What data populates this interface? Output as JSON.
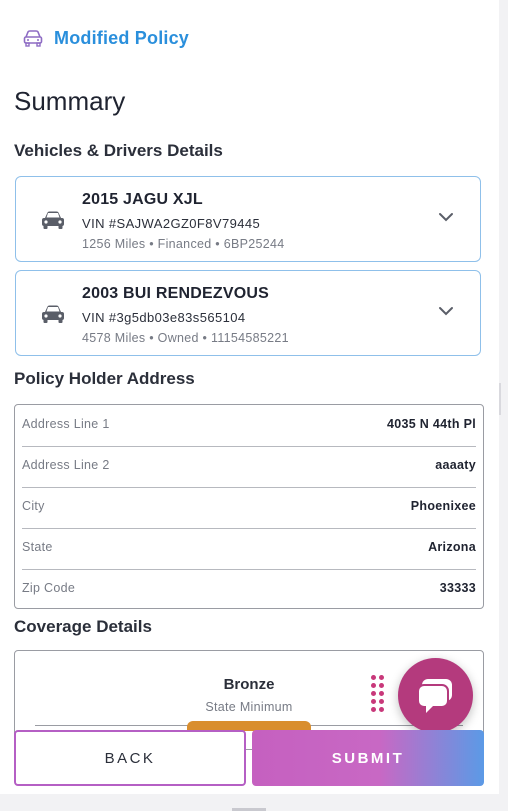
{
  "header": {
    "title": "Modified Policy",
    "icon": "car-outline-icon"
  },
  "summary_title": "Summary",
  "vehicles_section_title": "Vehicles & Drivers Details",
  "vehicles": [
    {
      "title": "2015 JAGU XJL",
      "vin": "VIN #SAJWA2GZ0F8V79445",
      "meta": "1256 Miles • Financed • 6BP25244"
    },
    {
      "title": "2003 BUI RENDEZVOUS",
      "vin": "VIN #3g5db03e83s565104",
      "meta": "4578 Miles • Owned • 11154585221"
    }
  ],
  "address_section_title": "Policy Holder Address",
  "address": [
    {
      "label": "Address Line 1",
      "value": "4035 N 44th Pl"
    },
    {
      "label": "Address Line 2",
      "value": "aaaaty"
    },
    {
      "label": "City",
      "value": "Phoenixee"
    },
    {
      "label": "State",
      "value": "Arizona"
    },
    {
      "label": "Zip Code",
      "value": "33333"
    }
  ],
  "coverage_section_title": "Coverage Details",
  "coverage": {
    "name": "Bronze",
    "subtitle": "State Minimum"
  },
  "buttons": {
    "back": "BACK",
    "submit": "SUBMIT"
  },
  "colors": {
    "accent_blue": "#2a8fdc",
    "card_border": "#8fc0ea",
    "chat_bg": "#b43a7d",
    "tab_orange": "#d98e2e"
  }
}
